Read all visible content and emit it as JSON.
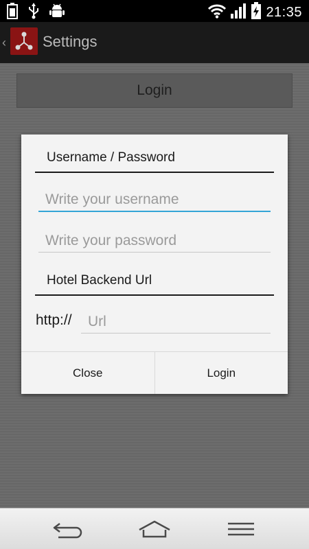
{
  "status_bar": {
    "time": "21:35",
    "icons": [
      "battery-full-icon",
      "usb-icon",
      "android-debug-icon",
      "wifi-icon",
      "signal-icon",
      "battery-charging-icon"
    ]
  },
  "action_bar": {
    "title": "Settings",
    "icon": "app-logo-icon"
  },
  "background": {
    "login_button_label": "Login"
  },
  "dialog": {
    "credentials_header": "Username / Password",
    "username_placeholder": "Write your username",
    "username_value": "",
    "password_placeholder": "Write your password",
    "password_value": "",
    "backend_header": "Hotel Backend Url",
    "url_prefix": "http://",
    "url_placeholder": "Url",
    "url_value": "",
    "close_label": "Close",
    "login_label": "Login"
  },
  "nav_bar": {
    "icons": [
      "back-icon",
      "home-icon",
      "menu-icon"
    ]
  },
  "colors": {
    "focus_accent": "#33a4d6",
    "app_icon_bg": "#8a1414"
  }
}
